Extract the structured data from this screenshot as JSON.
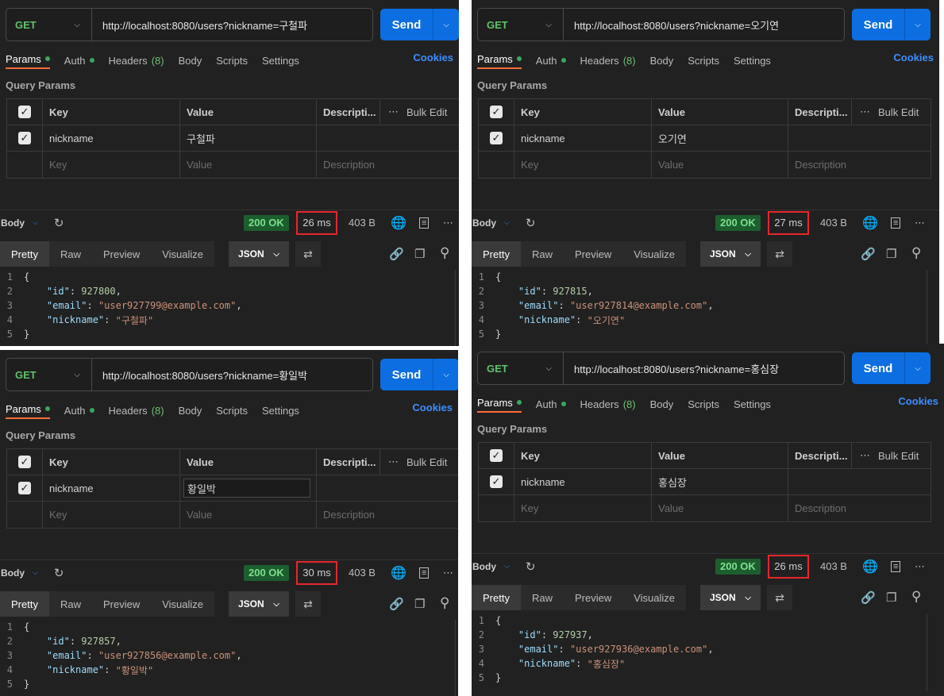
{
  "common": {
    "tabs": {
      "params": "Params",
      "auth": "Auth",
      "headers": "Headers",
      "headers_count": "(8)",
      "body": "Body",
      "scripts": "Scripts",
      "settings": "Settings",
      "cookies": "Cookies"
    },
    "query_params_title": "Query Params",
    "table": {
      "key_header": "Key",
      "value_header": "Value",
      "desc_header": "Descripti...",
      "bulk_edit": "Bulk Edit",
      "key_placeholder": "Key",
      "value_placeholder": "Value",
      "desc_placeholder": "Description"
    },
    "send": "Send",
    "body_label": "Body",
    "view_tabs": {
      "pretty": "Pretty",
      "raw": "Raw",
      "preview": "Preview",
      "visualize": "Visualize"
    },
    "format": "JSON",
    "accent_color": "#0c6ee0",
    "status_color": "#7ee08d",
    "highlight_color": "#e8262b"
  },
  "panels": [
    {
      "method": "GET",
      "url": "http://localhost:8080/users?nickname=구철파",
      "param_key": "nickname",
      "param_value": "구철파",
      "status": "200 OK",
      "time": "26 ms",
      "size": "403 B",
      "json": {
        "id": "927800",
        "email": "\"user927799@example.com\"",
        "nickname": "\"구철파\""
      },
      "lines": [
        "1",
        "2",
        "3",
        "4",
        "5"
      ]
    },
    {
      "method": "GET",
      "url": "http://localhost:8080/users?nickname=오기연",
      "param_key": "nickname",
      "param_value": "오기연",
      "status": "200 OK",
      "time": "27 ms",
      "size": "403 B",
      "json": {
        "id": "927815",
        "email": "\"user927814@example.com\"",
        "nickname": "\"오기연\""
      },
      "lines": [
        "1",
        "2",
        "3",
        "4",
        "5"
      ]
    },
    {
      "method": "GET",
      "url": "http://localhost:8080/users?nickname=황일박",
      "param_key": "nickname",
      "param_value": "황일박",
      "status": "200 OK",
      "time": "30 ms",
      "size": "403 B",
      "json": {
        "id": "927857",
        "email": "\"user927856@example.com\"",
        "nickname": "\"황일박\""
      },
      "lines": [
        "1",
        "2",
        "3",
        "4",
        "5"
      ]
    },
    {
      "method": "GET",
      "url": "http://localhost:8080/users?nickname=홍심장",
      "param_key": "nickname",
      "param_value": "홍심장",
      "status": "200 OK",
      "time": "26 ms",
      "size": "403 B",
      "json": {
        "id": "927937",
        "email": "\"user927936@example.com\"",
        "nickname": "\"홍심장\""
      },
      "lines": [
        "1",
        "2",
        "3",
        "4",
        "5"
      ]
    }
  ]
}
